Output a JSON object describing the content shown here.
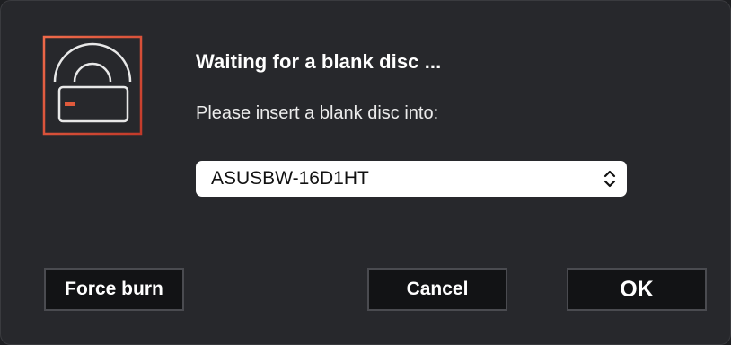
{
  "dialog": {
    "title": "Waiting for a blank disc ...",
    "message": "Please insert a blank disc into:",
    "app_icon": "burn-disc-icon",
    "accent_color": "#e05a3c"
  },
  "drive_select": {
    "selected": "ASUSBW-16D1HT",
    "indicator_icon": "chevron-up-down-icon"
  },
  "buttons": {
    "force_burn": "Force burn",
    "cancel": "Cancel",
    "ok": "OK"
  }
}
